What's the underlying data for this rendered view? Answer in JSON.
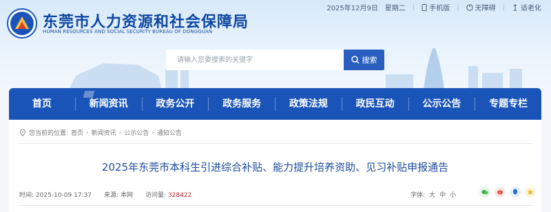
{
  "header": {
    "title_cn": "东莞市人力资源和社会保障局",
    "title_en": "HUMAN RESOURCES AND SOCIAL SECURITY BUREAU OF DONGGUAN",
    "date": "2025年12月9日",
    "weekday": "星期二",
    "links": [
      "手机版",
      "无障碍",
      "适老化"
    ]
  },
  "search": {
    "placeholder": "请输入您要搜索的关键字",
    "button_label": "搜索"
  },
  "nav": {
    "items": [
      "首页",
      "新闻资讯",
      "政务公开",
      "政务服务",
      "政策法规",
      "政民互动",
      "公示公告",
      "专题专栏"
    ],
    "active_index": 1
  },
  "breadcrumb": {
    "prefix": "您当前的位置:",
    "items": [
      "首页",
      "新闻资讯",
      "公示公告",
      "通知公告"
    ]
  },
  "article": {
    "title": "2025年东莞市本科生引进综合补贴、能力提升培养资助、见习补贴申报通告",
    "time_label": "时间:",
    "time": "2025-10-09 17:37",
    "source_label": "来源:",
    "source": "本网",
    "hits_label": "访问量:",
    "hits": "328422",
    "font_label": "字体:",
    "font_sizes": [
      "大",
      "中",
      "小"
    ]
  },
  "colors": {
    "brand": "#1a54b8",
    "title": "#0e47a1",
    "hits": "#c62828"
  }
}
